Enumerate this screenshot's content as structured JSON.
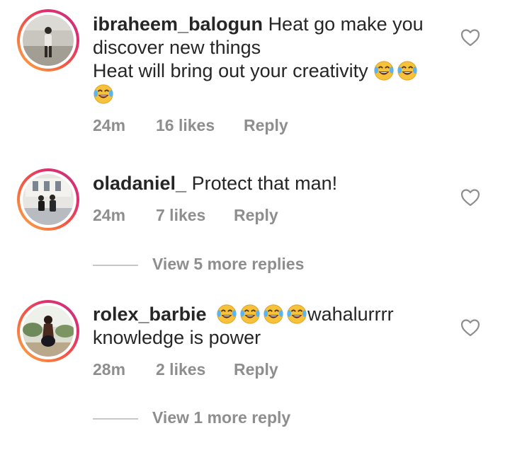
{
  "comments": [
    {
      "username": "ibraheem_balogun",
      "line1": "Heat go make you",
      "line2": "discover new things",
      "line3": "Heat will bring out your creativity",
      "emoji": "joy-emoji",
      "time": "24m",
      "likes": "16 likes",
      "reply": "Reply"
    },
    {
      "username": "oladaniel_",
      "text": "Protect that man!",
      "time": "24m",
      "likes": "7 likes",
      "reply": "Reply",
      "view_replies": "View 5 more replies"
    },
    {
      "username": "rolex_barbie",
      "text_after_emoji": "wahalurrrr",
      "line2": "knowledge is power",
      "emoji": "joy-emoji",
      "time": "28m",
      "likes": "2 likes",
      "reply": "Reply",
      "view_replies": "View 1 more reply"
    }
  ],
  "colors": {
    "text": "#262626",
    "meta": "#8e8e8e",
    "ring_start": "#c13584",
    "ring_end": "#fcaf45"
  },
  "icons": {
    "like": "heart-outline-icon"
  }
}
